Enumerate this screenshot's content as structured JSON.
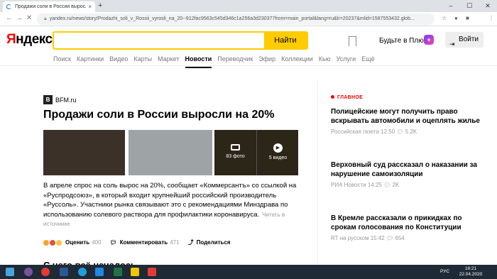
{
  "browser": {
    "tab_title": "Продажи соли в России выросли",
    "tab_close": "×",
    "new_tab": "+",
    "url": "yandex.ru/news/story/Prodazhi_soli_v_Rossii_vyrosli_na_20--912fac9563c545d346c1a256a3d230377from=main_portal&lang=ru&lr=20237&mlid=1587553432.glob...",
    "window_controls": [
      "–",
      "☐",
      "✕"
    ]
  },
  "header": {
    "logo_first": "Я",
    "logo_rest": "ндекс",
    "search_placeholder": "",
    "search_button": "Найти",
    "plus_label": "Будьте в Плюсе",
    "plus_icon": "+",
    "login_label": "Войти"
  },
  "services": [
    "Поиск",
    "Картинки",
    "Видео",
    "Карты",
    "Маркет",
    "Новости",
    "Переводчик",
    "Эфир",
    "Коллекции",
    "Кью",
    "Услуги",
    "Ещё"
  ],
  "active_service": "Новости",
  "story": {
    "source_icon": "B",
    "source": "BFM.ru",
    "title": "Продажи соли в России выросли на 20%",
    "photos_label": "83 фото",
    "videos_label": "5 видео",
    "lead": "В апреле спрос на соль вырос на 20%, сообщает «Коммерсантъ» со ссылкой на «Руспродсоюз», в который входит крупнейший российский производитель «Руссоль». Участники рынка связывают это с рекомендациями Минздрава по использованию солевого раствора для профилактики коронавируса.",
    "read_source": "Читать в источнике",
    "rate_label": "Оценить",
    "rate_count": "400",
    "comment_label": "Комментировать",
    "comment_count": "471",
    "share_label": "Поделиться",
    "next_heading": "С чего всё началось"
  },
  "sidebar": {
    "heading": "ГЛАВНОЕ",
    "items": [
      {
        "title": "Полицейские могут получить право вскрывать автомобили и оцеплять жилье",
        "source": "Российская газета 12:50",
        "views": "5.2K"
      },
      {
        "title": "Верховный суд рассказал о наказании за нарушение самоизоляции",
        "source": "РИА Новости 14:25",
        "views": "2K"
      },
      {
        "title": "В Кремле рассказали о прикидках по срокам голосования по Конституции",
        "source": "RT на русском 15:42",
        "views": "654"
      }
    ]
  },
  "taskbar": {
    "time": "16:21",
    "date": "22.04.2020",
    "lang": "РУС"
  },
  "colors": {
    "accent": "#ffcc00",
    "logo_red": "#ff0000",
    "headline_red": "#e00000"
  }
}
